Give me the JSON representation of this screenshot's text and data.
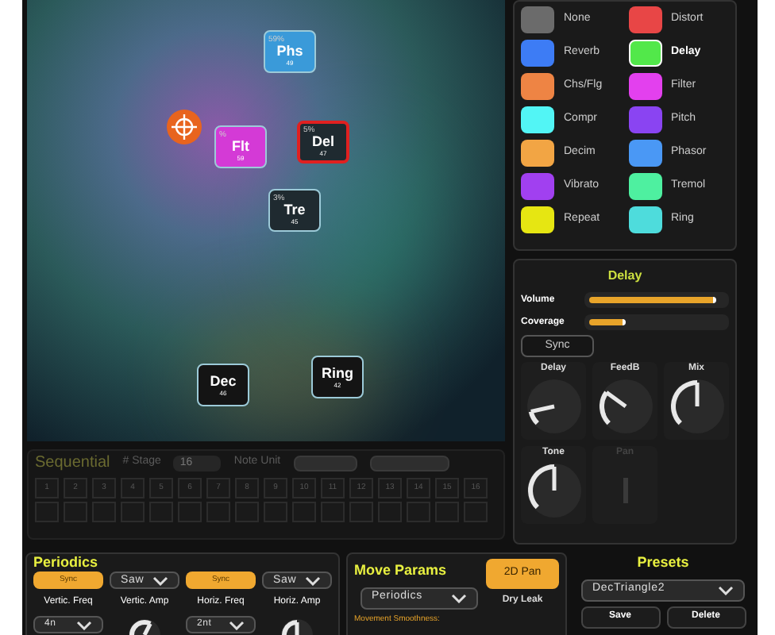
{
  "pad": {
    "nodes": [
      {
        "label": "Phs",
        "percent": "59%",
        "value": "49",
        "color": "#3a9ad9",
        "selected": false
      },
      {
        "label": "Flt",
        "percent": "%",
        "value": "59",
        "color": "#d43ad6",
        "selected": false
      },
      {
        "label": "Del",
        "percent": "5%",
        "value": "47",
        "color": "#1f2a30",
        "selected": true
      },
      {
        "label": "Tre",
        "percent": "3%",
        "value": "45",
        "color": "#1f2a30",
        "selected": false
      },
      {
        "label": "Dec",
        "value": "46",
        "color": "#141414",
        "selected": false
      },
      {
        "label": "Ring",
        "value": "42",
        "color": "#141414",
        "selected": false
      }
    ]
  },
  "effects": [
    {
      "label": "None",
      "color": "#6b6b6b",
      "selected": false
    },
    {
      "label": "Distort",
      "color": "#e84646",
      "selected": false
    },
    {
      "label": "Reverb",
      "color": "#3d7cf5",
      "selected": false
    },
    {
      "label": "Delay",
      "color": "#52e84a",
      "selected": true
    },
    {
      "label": "Chs/Flg",
      "color": "#ee8444",
      "selected": false
    },
    {
      "label": "Filter",
      "color": "#e340ee",
      "selected": false
    },
    {
      "label": "Compr",
      "color": "#52f5f5",
      "selected": false
    },
    {
      "label": "Pitch",
      "color": "#8a44f2",
      "selected": false
    },
    {
      "label": "Decim",
      "color": "#f2a544",
      "selected": false
    },
    {
      "label": "Phasor",
      "color": "#4a98f5",
      "selected": false
    },
    {
      "label": "Vibrato",
      "color": "#a140f0",
      "selected": false
    },
    {
      "label": "Tremol",
      "color": "#4ef0a0",
      "selected": false
    },
    {
      "label": "Repeat",
      "color": "#e6e612",
      "selected": false
    },
    {
      "label": "Ring",
      "color": "#4edcdc",
      "selected": false
    }
  ],
  "effect_panel": {
    "title": "Delay",
    "sliders": [
      {
        "label": "Volume",
        "level": 0.94
      },
      {
        "label": "Coverage",
        "level": 0.27
      }
    ],
    "sync": {
      "label": "Sync",
      "on": false
    },
    "knobs": [
      {
        "label": "Delay",
        "level": 0.12,
        "disabled": false
      },
      {
        "label": "FeedB",
        "level": 0.3,
        "disabled": false
      },
      {
        "label": "Mix",
        "level": 0.5,
        "disabled": false
      },
      {
        "label": "Tone",
        "level": 0.5,
        "disabled": false
      },
      {
        "label": "Pan",
        "disabled": true
      }
    ]
  },
  "sequential": {
    "title": "Sequential",
    "stage_label": "# Stage",
    "stage_value": "16",
    "note_unit_label": "Note Unit",
    "steps": [
      "1",
      "2",
      "3",
      "4",
      "5",
      "6",
      "7",
      "8",
      "9",
      "10",
      "11",
      "12",
      "13",
      "14",
      "15",
      "16"
    ]
  },
  "periodics": {
    "title": "Periodics",
    "top": [
      {
        "kind": "toggle",
        "label": "Sync",
        "on": true
      },
      {
        "kind": "dropdown",
        "label": "Saw"
      },
      {
        "kind": "toggle",
        "label": "Sync",
        "on": true
      },
      {
        "kind": "dropdown",
        "label": "Saw"
      }
    ],
    "params": [
      {
        "label": "Vertic. Freq",
        "kind": "dropdown",
        "value": "4n"
      },
      {
        "label": "Vertic. Amp",
        "kind": "knob",
        "level": 0.6
      },
      {
        "label": "Horiz. Freq",
        "kind": "dropdown",
        "value": "2nt"
      },
      {
        "label": "Horiz. Amp",
        "kind": "knob",
        "level": 0.5
      }
    ]
  },
  "move_params": {
    "title": "Move Params",
    "mode": "Periodics",
    "pan_button": {
      "label": "2D Pan",
      "on": true
    },
    "dry_leak_label": "Dry Leak",
    "smoothness_label": "Movement Smoothness:"
  },
  "presets": {
    "title": "Presets",
    "current": "DecTriangle2",
    "buttons": [
      "Save",
      "Delete"
    ]
  }
}
